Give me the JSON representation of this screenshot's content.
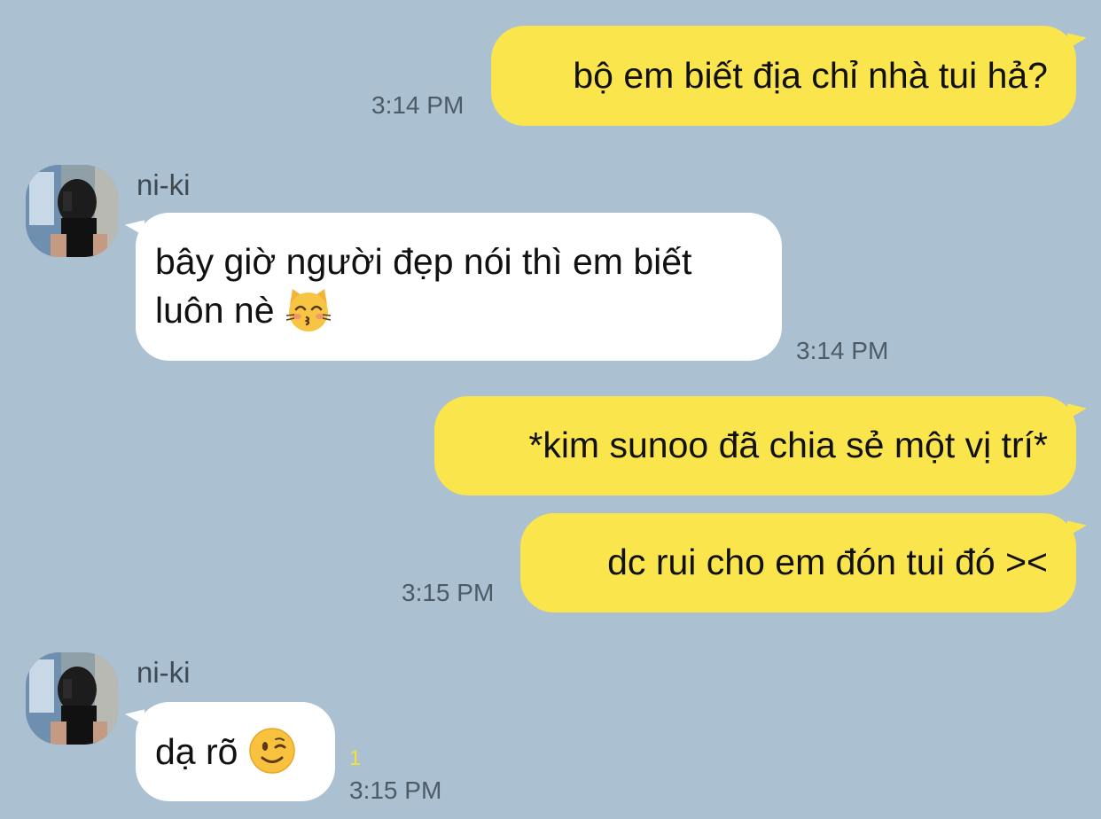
{
  "contact": {
    "name": "ni-ki"
  },
  "messages": [
    {
      "id": "m1",
      "direction": "out",
      "text": "bộ em biết địa chỉ nhà tui hả?",
      "time": "3:14 PM"
    },
    {
      "id": "m2",
      "direction": "in",
      "sender": "ni-ki",
      "line1": "bây giờ người đẹp nói thì em biết",
      "line2": "luôn nè",
      "emoji": "kissing-cat-icon",
      "time": "3:14 PM"
    },
    {
      "id": "m3",
      "direction": "out",
      "text": "*kim sunoo đã chia sẻ một vị trí*"
    },
    {
      "id": "m4",
      "direction": "out",
      "text": "dc rui cho em đón tui đó ><",
      "time": "3:15 PM"
    },
    {
      "id": "m5",
      "direction": "in",
      "sender": "ni-ki",
      "text": "dạ rõ",
      "emoji": "winking-face-icon",
      "unread": "1",
      "time": "3:15 PM"
    }
  ],
  "colors": {
    "background": "#abc1d1",
    "outgoing_bubble": "#fae54d",
    "incoming_bubble": "#ffffff",
    "unread_counter": "#f3e03a",
    "timestamp": "#4d5b66"
  }
}
